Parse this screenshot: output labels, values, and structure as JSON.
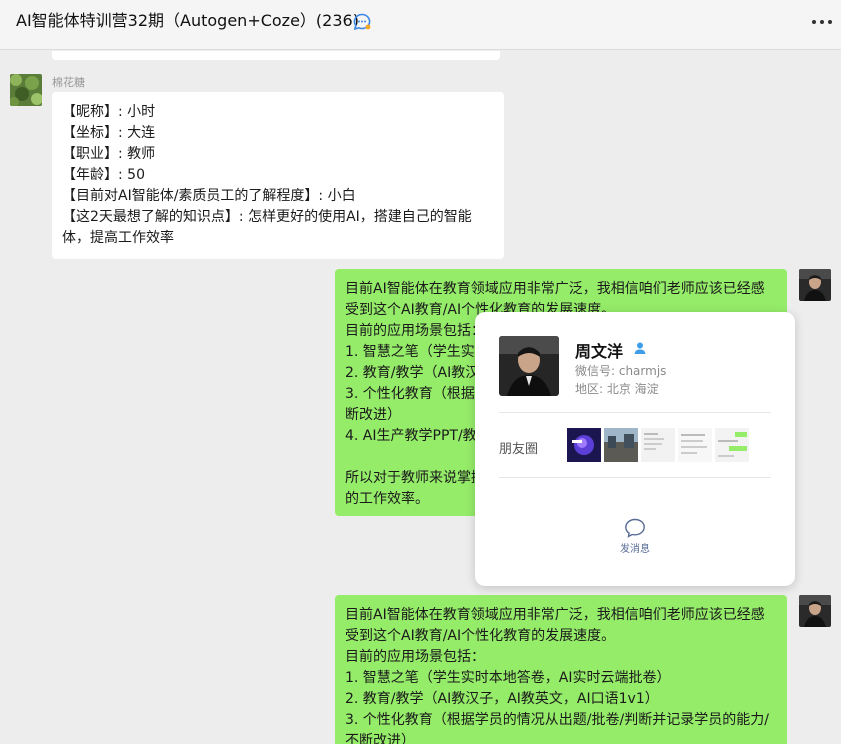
{
  "header": {
    "title": "AI智能体特训营32期（Autogen+Coze）(236)",
    "chat_icon": "chat-bubble-icon",
    "more_icon": "more-icon"
  },
  "messages": [
    {
      "sender": "棉花糖",
      "side": "left",
      "lines": [
        "【昵称】: 小时",
        "【坐标】: 大连",
        "【职业】: 教师",
        "【年龄】: 50",
        "【目前对AI智能体/素质员工的了解程度】: 小白",
        "【这2天最想了解的知识点】:  怎样更好的使用AI，搭建自己的智能体，提高工作效率"
      ]
    },
    {
      "side": "right",
      "lines": [
        "目前AI智能体在教育领域应用非常广泛，我相信咱们老师应该已经感受到这个AI教育/AI个性化教育的发展速度。",
        "目前的应用场景包括：",
        "1. 智慧之笔（学生实时",
        "2. 教育/教学（AI教汉",
        "3. 个性化教育（根据学",
        "断改进）",
        "4. AI生产教学PPT/教",
        "",
        "所以对于教师来说掌握",
        "的工作效率。"
      ]
    },
    {
      "side": "right",
      "lines": [
        "目前AI智能体在教育领域应用非常广泛，我相信咱们老师应该已经感受到这个AI教育/AI个性化教育的发展速度。",
        "目前的应用场景包括：",
        "1. 智慧之笔（学生实时本地答卷，AI实时云端批卷）",
        "2. 教育/教学（AI教汉子，AI教英文，AI口语1v1）",
        "3. 个性化教育（根据学员的情况从出题/批卷/判断并记录学员的能力/不断改进）"
      ]
    }
  ],
  "profile_card": {
    "name": "周文洋",
    "wechat_id": "微信号: charmjs",
    "region": "地区: 北京 海淀",
    "moments_label": "朋友圈",
    "send_message_label": "发消息",
    "colors": {
      "link": "#576b95",
      "person_icon": "#3d9de8"
    }
  },
  "colors": {
    "self_bubble": "#95ec69",
    "other_bubble": "#ffffff",
    "background": "#ededed"
  }
}
